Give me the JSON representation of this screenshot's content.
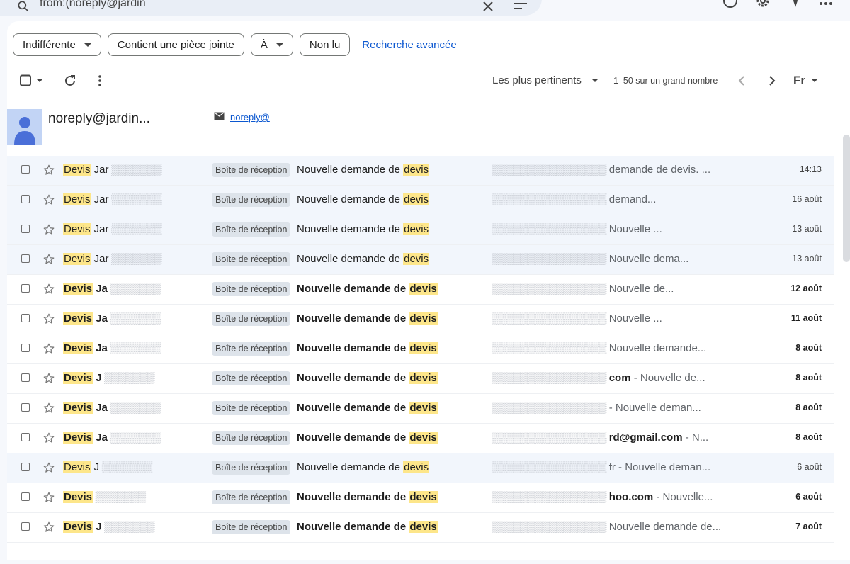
{
  "search": {
    "query": "from:(noreply@jardin",
    "rest": ""
  },
  "chips": [
    {
      "label": "Indifférente",
      "dropdown": true
    },
    {
      "label": "Contient une pièce jointe",
      "dropdown": false
    },
    {
      "label": "À",
      "dropdown": true
    },
    {
      "label": "Non lu",
      "dropdown": false
    }
  ],
  "advanced_search": "Recherche avancée",
  "toolbar": {
    "sort_label": "Les plus pertinents",
    "range": "1–50 sur un grand nombre",
    "lang": "Fr"
  },
  "contact": {
    "name": "noreply@jardin...",
    "email": "noreply@"
  },
  "rows": [
    {
      "sender_hl": "Devis",
      "sender_rest": " Jar",
      "label": "Boîte de réception",
      "subject_pre": "Nouvelle demande de ",
      "subject_hl": "devis",
      "snippet_pre": "",
      "snippet_bold": "",
      "snippet_post": "demande de devis. ...",
      "date": "14:13",
      "unread": false
    },
    {
      "sender_hl": "Devis",
      "sender_rest": " Jar",
      "label": "Boîte de réception",
      "subject_pre": "Nouvelle demande de ",
      "subject_hl": "devis",
      "snippet_pre": "",
      "snippet_bold": "",
      "snippet_post": "demand...",
      "date": "16 août",
      "unread": false
    },
    {
      "sender_hl": "Devis",
      "sender_rest": " Jar",
      "label": "Boîte de réception",
      "subject_pre": "Nouvelle demande de ",
      "subject_hl": "devis",
      "snippet_pre": "",
      "snippet_bold": "",
      "snippet_post": "Nouvelle ...",
      "date": "13 août",
      "unread": false
    },
    {
      "sender_hl": "Devis",
      "sender_rest": " Jar",
      "label": "Boîte de réception",
      "subject_pre": "Nouvelle demande de ",
      "subject_hl": "devis",
      "snippet_pre": "",
      "snippet_bold": "",
      "snippet_post": "Nouvelle dema...",
      "date": "13 août",
      "unread": false
    },
    {
      "sender_hl": "Devis",
      "sender_rest": " Ja",
      "label": "Boîte de réception",
      "subject_pre": "Nouvelle demande de ",
      "subject_hl": "devis",
      "snippet_pre": "",
      "snippet_bold": "",
      "snippet_post": "Nouvelle de...",
      "date": "12 août",
      "unread": true
    },
    {
      "sender_hl": "Devis",
      "sender_rest": " Ja",
      "label": "Boîte de réception",
      "subject_pre": "Nouvelle demande de ",
      "subject_hl": "devis",
      "snippet_pre": "",
      "snippet_bold": "",
      "snippet_post": "Nouvelle ...",
      "date": "11 août",
      "unread": true
    },
    {
      "sender_hl": "Devis",
      "sender_rest": " Ja",
      "label": "Boîte de réception",
      "subject_pre": "Nouvelle demande de ",
      "subject_hl": "devis",
      "snippet_pre": "",
      "snippet_bold": "",
      "snippet_post": "Nouvelle demande...",
      "date": "8 août",
      "unread": true
    },
    {
      "sender_hl": "Devis",
      "sender_rest": " J",
      "label": "Boîte de réception",
      "subject_pre": "Nouvelle demande de ",
      "subject_hl": "devis",
      "snippet_pre": "",
      "snippet_bold": "com",
      "snippet_post": " - Nouvelle de...",
      "date": "8 août",
      "unread": true
    },
    {
      "sender_hl": "Devis",
      "sender_rest": " Ja",
      "label": "Boîte de réception",
      "subject_pre": "Nouvelle demande de ",
      "subject_hl": "devis",
      "snippet_pre": "",
      "snippet_bold": "",
      "snippet_post": "- Nouvelle deman...",
      "date": "8 août",
      "unread": true
    },
    {
      "sender_hl": "Devis",
      "sender_rest": " Ja",
      "label": "Boîte de réception",
      "subject_pre": "Nouvelle demande de ",
      "subject_hl": "devis",
      "snippet_pre": "",
      "snippet_bold": "rd@gmail.com",
      "snippet_post": " - N...",
      "date": "8 août",
      "unread": true
    },
    {
      "sender_hl": "Devis",
      "sender_rest": " J",
      "label": "Boîte de réception",
      "subject_pre": "Nouvelle demande de ",
      "subject_hl": "devis",
      "snippet_pre": "fr",
      "snippet_bold": "",
      "snippet_post": " - Nouvelle deman...",
      "date": "6 août",
      "unread": false
    },
    {
      "sender_hl": "Devis",
      "sender_rest": "",
      "label": "Boîte de réception",
      "subject_pre": "Nouvelle demande de ",
      "subject_hl": "devis",
      "snippet_pre": "",
      "snippet_bold": "hoo.com",
      "snippet_post": " - Nouvelle...",
      "date": "6 août",
      "unread": true
    },
    {
      "sender_hl": "Devis",
      "sender_rest": " J",
      "label": "Boîte de réception",
      "subject_pre": "Nouvelle demande de ",
      "subject_hl": "devis",
      "snippet_pre": "",
      "snippet_bold": "",
      "snippet_post": "Nouvelle demande de...",
      "date": "7 août",
      "unread": true
    }
  ],
  "colors": {
    "highlight": "#fde68a",
    "link": "#0b57d0",
    "label_bg": "#dde3ea",
    "read_row_bg": "#f2f6fc"
  }
}
